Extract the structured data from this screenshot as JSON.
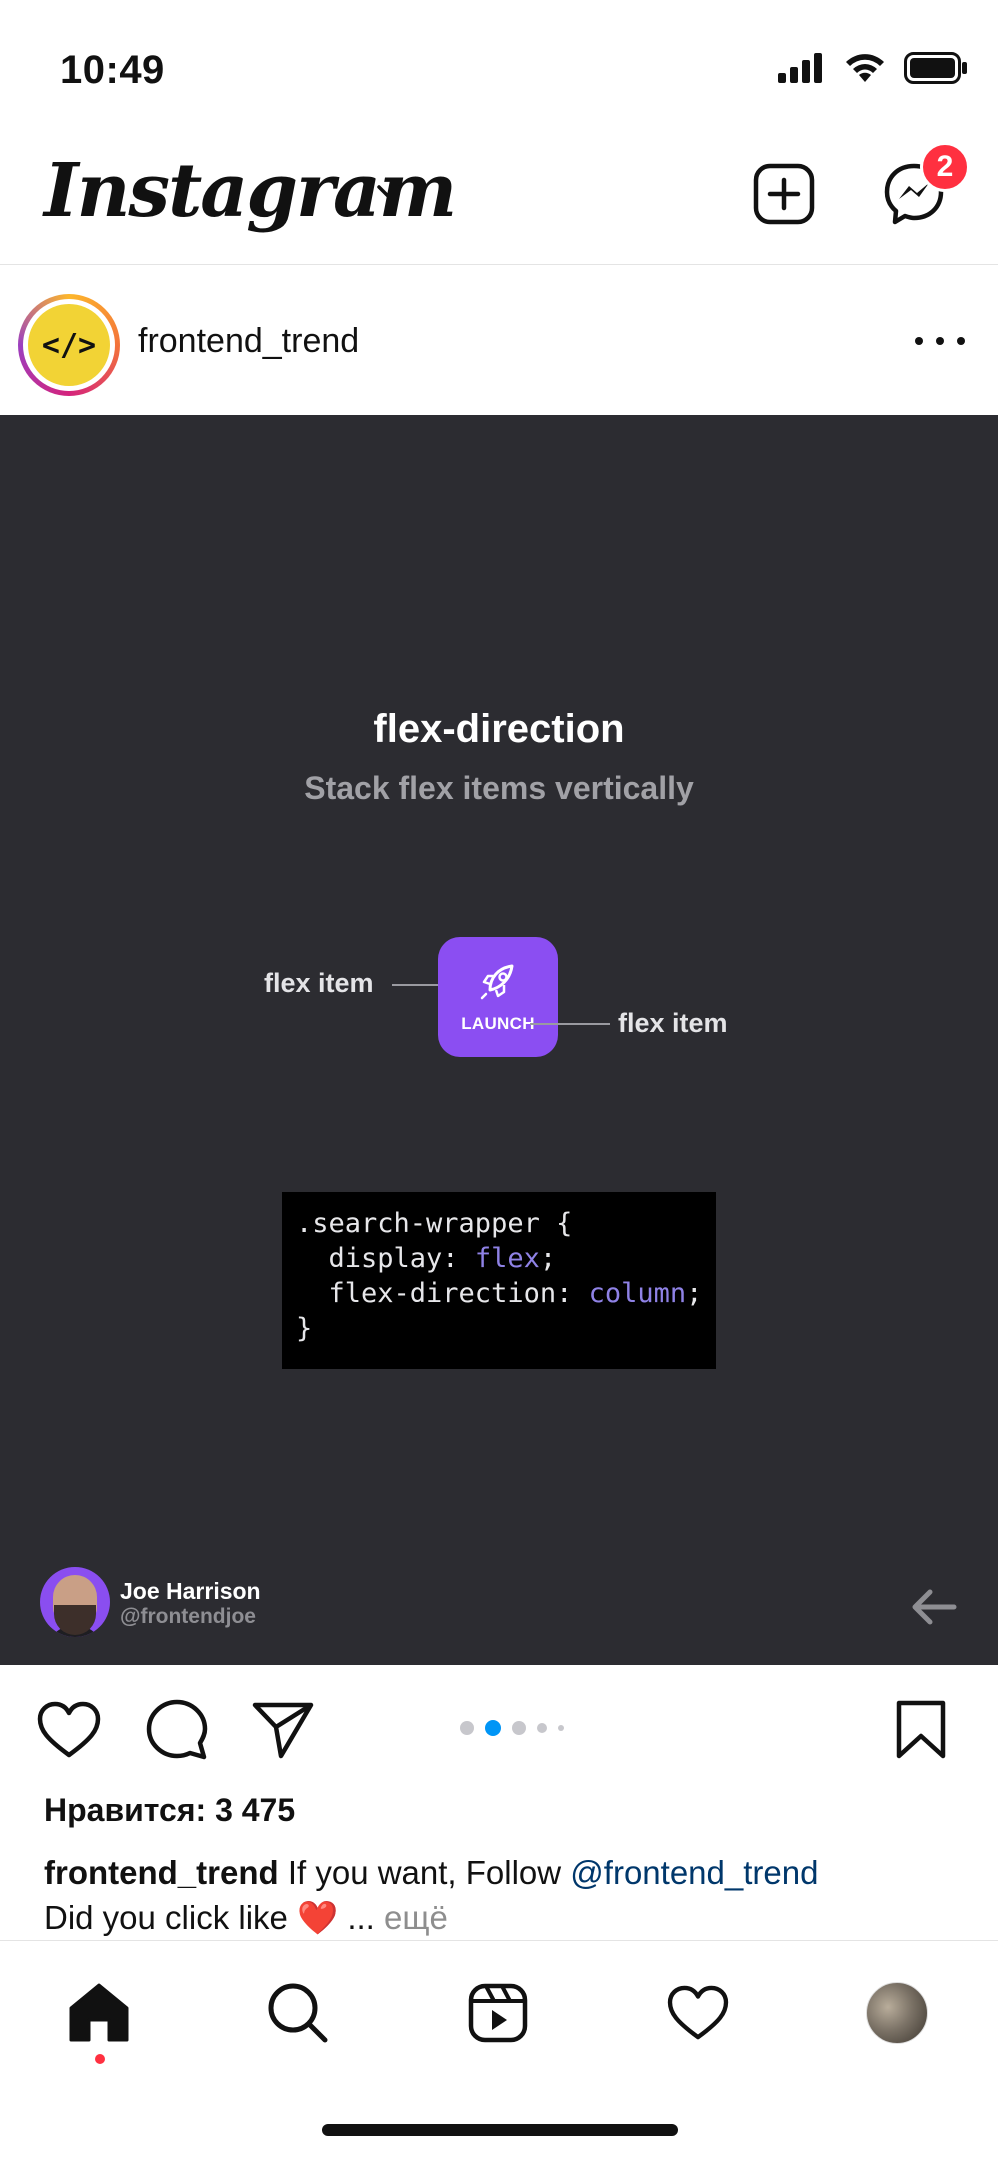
{
  "status_bar": {
    "time": "10:49",
    "icons": [
      "signal-icon",
      "wifi-icon",
      "battery-icon"
    ]
  },
  "header": {
    "logo": "Instagram",
    "messenger_badge": "2",
    "icons": [
      "chevron-down-icon",
      "new-post-icon",
      "messenger-icon"
    ]
  },
  "post": {
    "avatar_text": "</>",
    "username": "frontend_trend",
    "slide": {
      "title": "flex-direction",
      "subtitle": "Stack flex items vertically",
      "tile_label": "LAUNCH",
      "label_left": "flex item",
      "label_right": "flex item",
      "code": {
        "line1": ".search-wrapper {",
        "line2_prop": "  display: ",
        "line2_val": "flex",
        "line2_end": ";",
        "line3_prop": "  flex-direction: ",
        "line3_val": "column",
        "line3_end": ";",
        "line4": "}"
      },
      "author_name": "Joe Harrison",
      "author_handle": "@frontendjoe",
      "code_keyword_color": "#8f82e6",
      "background_color": "#2c2c31",
      "tile_color": "#8b4ef2"
    },
    "carousel": {
      "count": 5,
      "active_index": 1
    },
    "likes": "Нравится: 3 475",
    "caption": {
      "username": "frontend_trend",
      "text": " If you want, Follow ",
      "mention": "@frontend_trend",
      "line2": "Did you click like ",
      "emoji": "❤️",
      "ellipsis": " ... ",
      "more": "ещё"
    }
  },
  "bottom_nav": {
    "items": [
      "home-icon",
      "search-icon",
      "reels-icon",
      "activity-heart-icon",
      "profile-avatar"
    ],
    "active": "home-icon",
    "accent_color": "#ff3040"
  }
}
